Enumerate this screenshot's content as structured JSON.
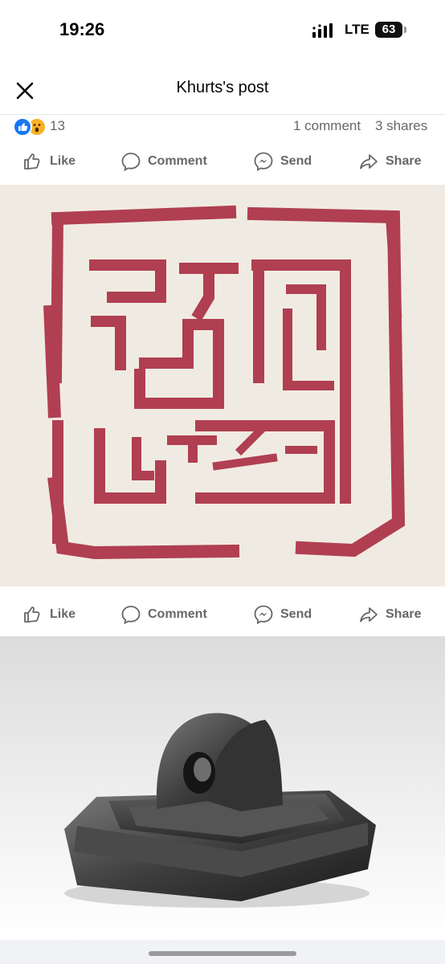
{
  "status": {
    "time": "19:26",
    "network": "LTE",
    "battery": "63"
  },
  "header": {
    "title": "Khurts's post",
    "close_icon": "close-icon"
  },
  "reactions": {
    "count": "13",
    "comments": "1 comment",
    "shares": "3 shares",
    "icons": [
      "like-reaction-icon",
      "wow-reaction-icon"
    ]
  },
  "actions": {
    "like": "Like",
    "comment": "Comment",
    "send": "Send",
    "share": "Share"
  },
  "colors": {
    "accent": "#1877f2",
    "seal_red": "#a8283e",
    "paper": "#f3eee6",
    "text_muted": "#65676b"
  }
}
